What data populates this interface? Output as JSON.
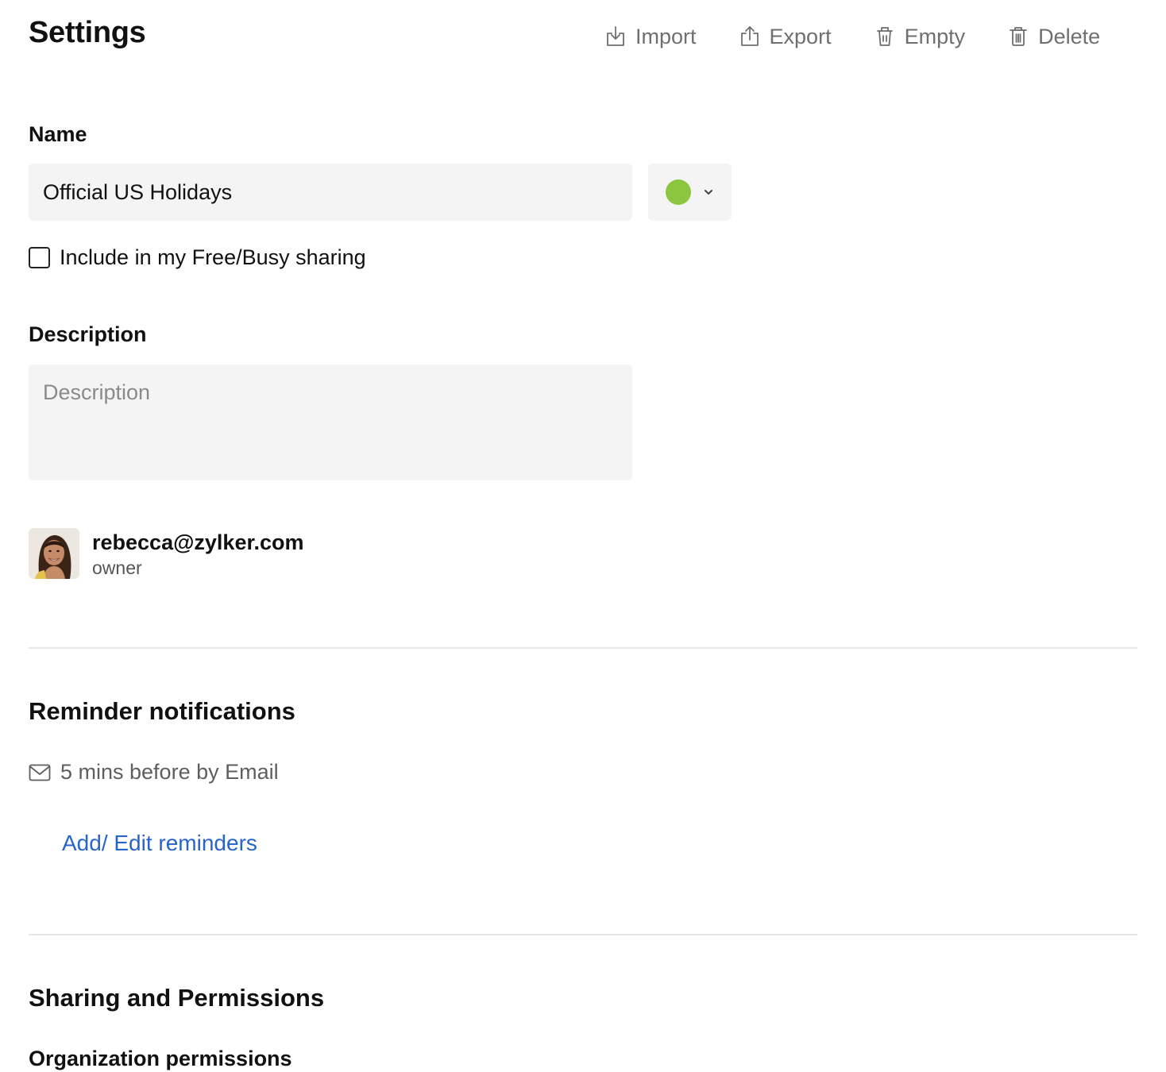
{
  "header": {
    "title": "Settings",
    "actions": [
      {
        "label": "Import",
        "icon": "import-icon"
      },
      {
        "label": "Export",
        "icon": "export-icon"
      },
      {
        "label": "Empty",
        "icon": "empty-trash-icon"
      },
      {
        "label": "Delete",
        "icon": "delete-icon"
      }
    ]
  },
  "name": {
    "label": "Name",
    "value": "Official US Holidays",
    "color": "#8cc63f"
  },
  "free_busy": {
    "label": "Include in my Free/Busy sharing",
    "checked": false
  },
  "description": {
    "label": "Description",
    "value": "",
    "placeholder": "Description"
  },
  "owner": {
    "email": "rebecca@zylker.com",
    "role": "owner"
  },
  "reminders": {
    "title": "Reminder notifications",
    "items": [
      "5 mins before by Email"
    ],
    "edit_link": "Add/ Edit reminders"
  },
  "sharing": {
    "title": "Sharing and Permissions",
    "org_permissions": "Organization permissions"
  }
}
